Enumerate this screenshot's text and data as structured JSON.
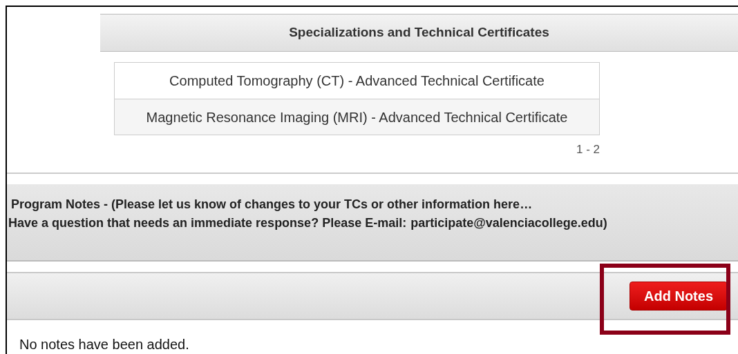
{
  "specializations": {
    "title": "Specializations and Technical Certificates",
    "rows": [
      "Computed Tomography (CT) - Advanced Technical Certificate",
      "Magnetic Resonance Imaging (MRI) - Advanced Technical Certificate"
    ],
    "pager": "1 - 2"
  },
  "notes": {
    "line_1": "Program Notes - (Please let us know of changes to your TCs or other information here…",
    "line_2": "Have a question that needs an immediate response? Please E-mail:",
    "email": "participate@valenciacollege.edu)"
  },
  "add_button": "Add Notes",
  "empty_message": "No notes have been added."
}
